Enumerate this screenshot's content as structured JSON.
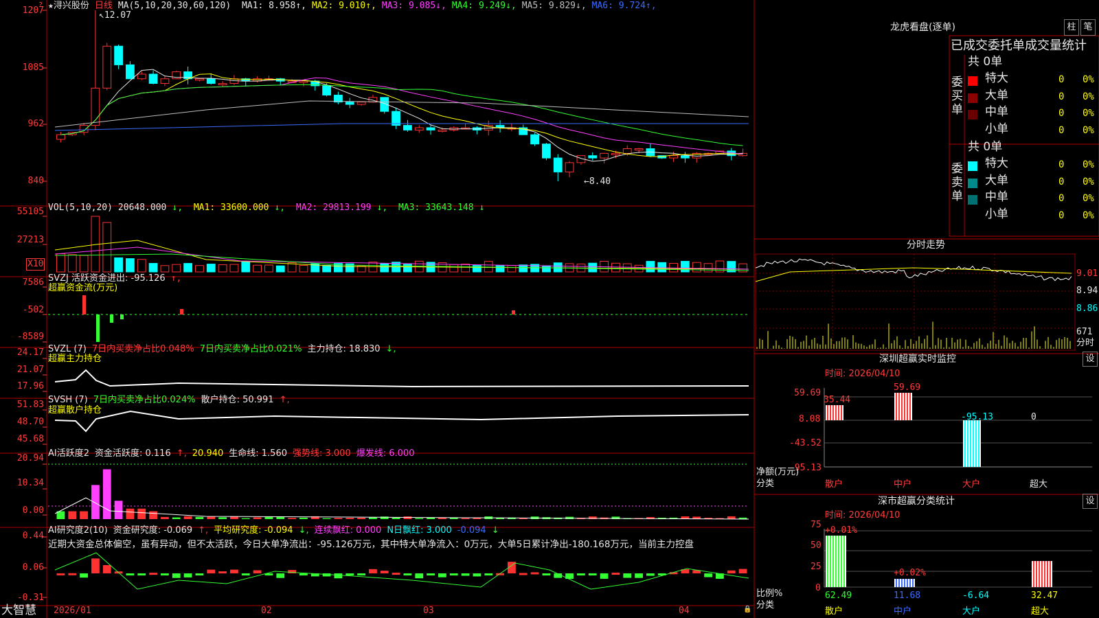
{
  "stock": {
    "name": "★浔兴股份",
    "period": "日线"
  },
  "ma": {
    "label": "MA(5,10,20,30,60,120)",
    "items": [
      {
        "text": "MA1: 8.958",
        "arrow": "↑",
        "color": "#e8e8e8"
      },
      {
        "text": "MA2: 9.010",
        "arrow": "↑",
        "color": "#ffff00"
      },
      {
        "text": "MA3: 9.085",
        "arrow": "↓",
        "color": "#ff40ff"
      },
      {
        "text": "MA4: 9.249",
        "arrow": "↓",
        "color": "#33ff33"
      },
      {
        "text": "MA5: 9.829",
        "arrow": "↓",
        "color": "#c0c0c0"
      },
      {
        "text": "MA6: 9.724",
        "arrow": "↑",
        "color": "#3c6cff"
      }
    ]
  },
  "price_axis": [
    "1207",
    "1085",
    "962",
    "840"
  ],
  "price_axis_mode": "小数点被截断显示",
  "high_label": "12.07",
  "low_label": "8.40",
  "vol": {
    "label": "VOL(5,10,20)",
    "value": "20648.000",
    "ma1": "MA1: 33600.000",
    "ma2": "MA2: 29813.199",
    "ma3": "MA3: 33643.148",
    "axis": [
      "55105",
      "27213"
    ],
    "unit": "X10"
  },
  "svzj": {
    "label": "SVZJ  活跃资金进出: -95.126",
    "sub": "超赢资金流(万元)",
    "axis": [
      "7586",
      "-502",
      "-8589"
    ]
  },
  "svzl": {
    "label": "SVZL (7)",
    "t1": "7日内买卖净占比0.048%",
    "t2": "7日内买卖净占比0.021%",
    "t3": "主力持仓: 18.830",
    "sub": "超赢主力持仓",
    "axis": [
      "24.17",
      "21.07",
      "17.96"
    ]
  },
  "svsh": {
    "label": "SVSH (7)",
    "t1": "7日内买卖净占比0.024%",
    "t2": "散户持仓: 50.991",
    "sub": "超赢散户持仓",
    "axis": [
      "51.83",
      "48.70",
      "45.68"
    ]
  },
  "ai1": {
    "label": "AI活跃度2",
    "t1": "资金活跃度: 0.116",
    "t2": "20.940",
    "t3": "生命线: 1.560",
    "t4": "强势线: 3.000",
    "t5": "爆发线: 6.000",
    "axis": [
      "20.94",
      "10.34",
      "0.00"
    ]
  },
  "ai2": {
    "label": "AI研究度2(10)",
    "t1": "资金研究度: -0.069",
    "t2": "平均研究度: -0.094",
    "t3": "连续飘红: 0.000",
    "t4": "N日飘红: 3.000",
    "t5": "-0.094",
    "axis": [
      "0.44",
      "0.06",
      "-0.31"
    ],
    "comment": "近期大资金总体偏空，虽有异动，但不太活跃，今日大单净流出：-95.126万元，其中特大单净流入：0万元，大单5日累计净出-180.168万元，当前主力控盘"
  },
  "date_axis": [
    "2026/01",
    "02",
    "03",
    "04"
  ],
  "brand": "大智慧",
  "lhb": {
    "title": "龙虎看盘(逐单)",
    "tab1": "柱",
    "tab2": "笔",
    "header": "已成交委托单成交量统计",
    "buy": {
      "side": "委买单",
      "total": "共 0单",
      "rows": [
        {
          "name": "特大",
          "v": "0",
          "p": "0%",
          "color": "#ff0000"
        },
        {
          "name": "大单",
          "v": "0",
          "p": "0%",
          "color": "#8b0000"
        },
        {
          "name": "中单",
          "v": "0",
          "p": "0%",
          "color": "#6b0000"
        },
        {
          "name": "小单",
          "v": "0",
          "p": "0%",
          "color": ""
        }
      ]
    },
    "sell": {
      "side": "委卖单",
      "total": "共 0单",
      "rows": [
        {
          "name": "特大",
          "v": "0",
          "p": "0%",
          "color": "#00ffff"
        },
        {
          "name": "大单",
          "v": "0",
          "p": "0%",
          "color": "#008b8b"
        },
        {
          "name": "中单",
          "v": "0",
          "p": "0%",
          "color": "#007070"
        },
        {
          "name": "小单",
          "v": "0",
          "p": "0%",
          "color": ""
        }
      ]
    }
  },
  "intraday": {
    "title": "分时走势",
    "p1": "9.01",
    "p2": "8.94",
    "p3": "8.86",
    "vol": "671",
    "vol_label": "分时"
  },
  "monitor": {
    "title": "深圳超赢实时监控",
    "set": "设",
    "date": "时间: 2026/04/10",
    "axis": [
      "59.69",
      "8.08",
      "-43.52",
      "-95.13"
    ],
    "yaxis_label": "净额(万元)",
    "xaxis_label": "分类",
    "bars": [
      {
        "label": "散户",
        "value": "35.44"
      },
      {
        "label": "中户",
        "value": "59.69"
      },
      {
        "label": "大户",
        "value": "-95.13"
      },
      {
        "label": "超大",
        "value": "0"
      }
    ]
  },
  "classify": {
    "title": "深市超赢分类统计",
    "set": "设",
    "date": "时间: 2026/04/10",
    "axis": [
      "75",
      "50",
      "25",
      "0"
    ],
    "yaxis_label": "比例%",
    "xaxis_label": "分类",
    "bars": [
      {
        "label": "散户",
        "value": "62.49",
        "top": "+0.01%"
      },
      {
        "label": "中户",
        "value": "11.68",
        "top": "+0.02%"
      },
      {
        "label": "大户",
        "value": "-6.64",
        "top": ""
      },
      {
        "label": "超大",
        "value": "32.47",
        "top": ""
      }
    ]
  }
}
